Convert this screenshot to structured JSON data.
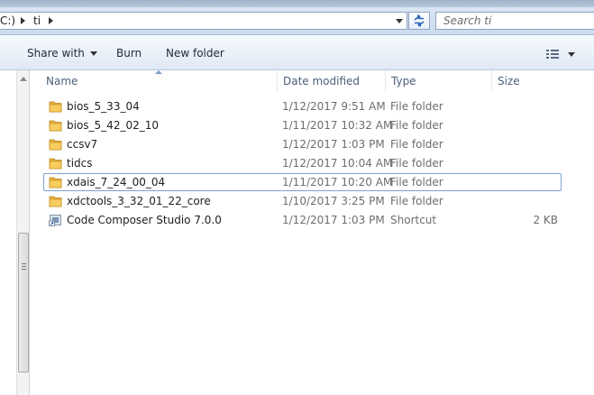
{
  "address": {
    "drive_label": "C:)",
    "folder": "ti"
  },
  "search": {
    "placeholder": "Search ti"
  },
  "toolbar": {
    "share_with": "Share with",
    "burn": "Burn",
    "new_folder": "New folder"
  },
  "columns": {
    "name": "Name",
    "date_modified": "Date modified",
    "type": "Type",
    "size": "Size"
  },
  "files": [
    {
      "name": "bios_5_33_04",
      "date": "1/12/2017 9:51 AM",
      "type": "File folder",
      "size": "",
      "icon": "folder-icon"
    },
    {
      "name": "bios_5_42_02_10",
      "date": "1/11/2017 10:32 AM",
      "type": "File folder",
      "size": "",
      "icon": "folder-icon"
    },
    {
      "name": "ccsv7",
      "date": "1/12/2017 1:03 PM",
      "type": "File folder",
      "size": "",
      "icon": "folder-icon"
    },
    {
      "name": "tidcs",
      "date": "1/12/2017 10:04 AM",
      "type": "File folder",
      "size": "",
      "icon": "folder-icon"
    },
    {
      "name": "xdais_7_24_00_04",
      "date": "1/11/2017 10:20 AM",
      "type": "File folder",
      "size": "",
      "icon": "folder-icon"
    },
    {
      "name": "xdctools_3_32_01_22_core",
      "date": "1/10/2017 3:25 PM",
      "type": "File folder",
      "size": "",
      "icon": "folder-icon"
    },
    {
      "name": "Code Composer Studio 7.0.0",
      "date": "1/12/2017 1:03 PM",
      "type": "Shortcut",
      "size": "2 KB",
      "icon": "shortcut-icon"
    }
  ],
  "focused_row": 4,
  "colors": {
    "folder": "#e8b13c",
    "header_text": "#4c607a",
    "focus_border": "#7da2ce"
  }
}
